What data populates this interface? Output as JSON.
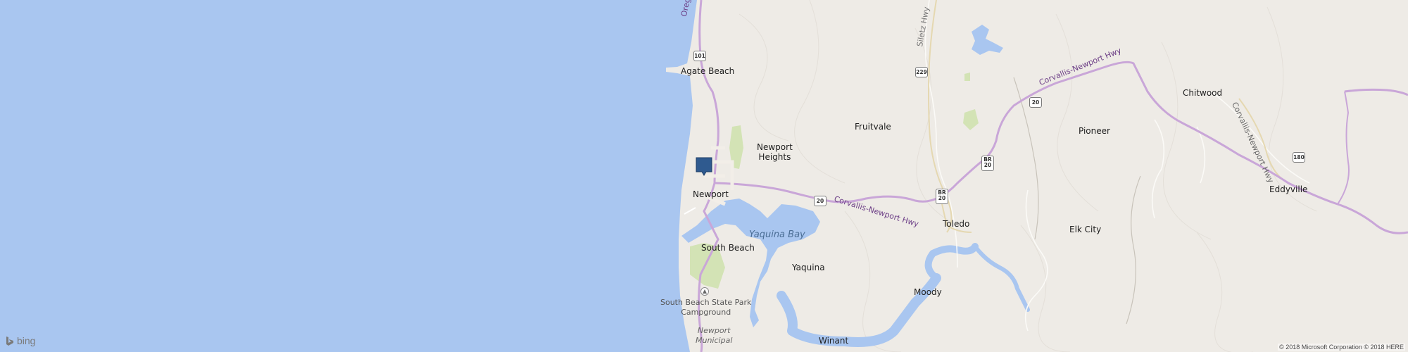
{
  "map": {
    "places": [
      {
        "id": "agate-beach",
        "label": "Agate Beach"
      },
      {
        "id": "newport-heights",
        "label": "Newport\nHeights"
      },
      {
        "id": "newport",
        "label": "Newport"
      },
      {
        "id": "south-beach",
        "label": "South Beach"
      },
      {
        "id": "yaquina",
        "label": "Yaquina"
      },
      {
        "id": "fruitvale",
        "label": "Fruitvale"
      },
      {
        "id": "toledo",
        "label": "Toledo"
      },
      {
        "id": "moody",
        "label": "Moody"
      },
      {
        "id": "winant",
        "label": "Winant"
      },
      {
        "id": "elk-city",
        "label": "Elk City"
      },
      {
        "id": "pioneer",
        "label": "Pioneer"
      },
      {
        "id": "chitwood",
        "label": "Chitwood"
      },
      {
        "id": "eddyville",
        "label": "Eddyville"
      }
    ],
    "water_labels": {
      "yaquina_bay": "Yaquina Bay"
    },
    "pois": {
      "south_beach_sp": "South Beach State Park\nCampground",
      "newport_municipal": "Newport\nMunicipal"
    },
    "road_labels": {
      "oregon_coast": "Oregon Coast",
      "siletz_hwy": "Siletz Hwy",
      "corvallis_newport_1": "Corvallis-Newport Hwy",
      "corvallis_newport_2": "Corvallis-Newport Hwy",
      "corvallis_newport_3": "Corvallis-Newport Hwy"
    },
    "shields": {
      "us101": "101",
      "or229": "229",
      "us20_a": "20",
      "us20_b": "20",
      "br20_a_top": "BR",
      "br20_a_bottom": "20",
      "br20_b_top": "BR",
      "br20_b_bottom": "20",
      "or180": "180"
    },
    "colors": {
      "ocean": "#a9c6f0",
      "land": "#eeebe6",
      "highway": "#c9a6d8",
      "park": "#d3e3b5",
      "marker": "#2f5a8f"
    }
  },
  "logo": {
    "text": "bing",
    "icon": "bing-logo-icon"
  },
  "copyright": "© 2018 Microsoft Corporation © 2018 HERE",
  "marker": {
    "icon": "location-pin-icon"
  }
}
